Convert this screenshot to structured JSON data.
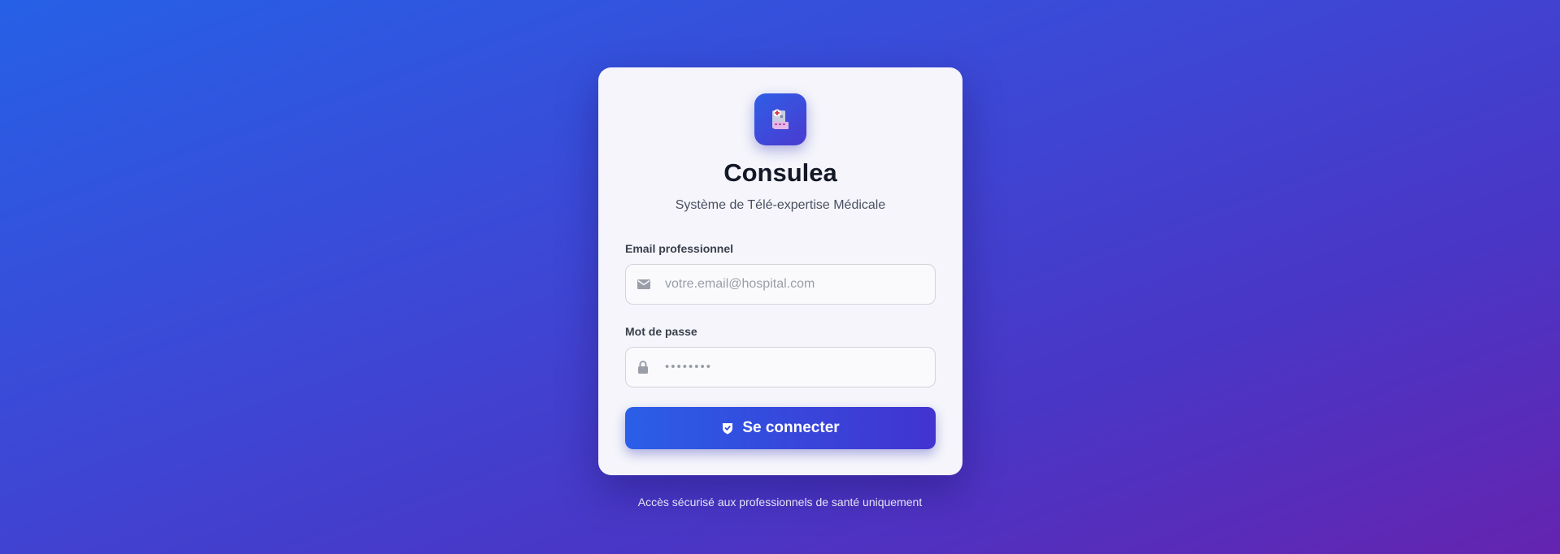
{
  "app": {
    "title": "Consulea",
    "subtitle": "Système de Télé-expertise Médicale",
    "logo_icon": "hospital-icon"
  },
  "form": {
    "email_label": "Email professionnel",
    "email_placeholder": "votre.email@hospital.com",
    "email_value": "",
    "email_icon": "envelope-icon",
    "password_label": "Mot de passe",
    "password_placeholder": "••••••••",
    "password_value": "",
    "password_icon": "lock-icon",
    "submit_label": "Se connecter",
    "submit_icon": "shield-check-icon"
  },
  "footer": {
    "text": "Accès sécurisé aux professionnels de santé uniquement"
  },
  "colors": {
    "primary": "#2a5fe8",
    "secondary": "#4233d0",
    "background_end": "#6424b0"
  }
}
